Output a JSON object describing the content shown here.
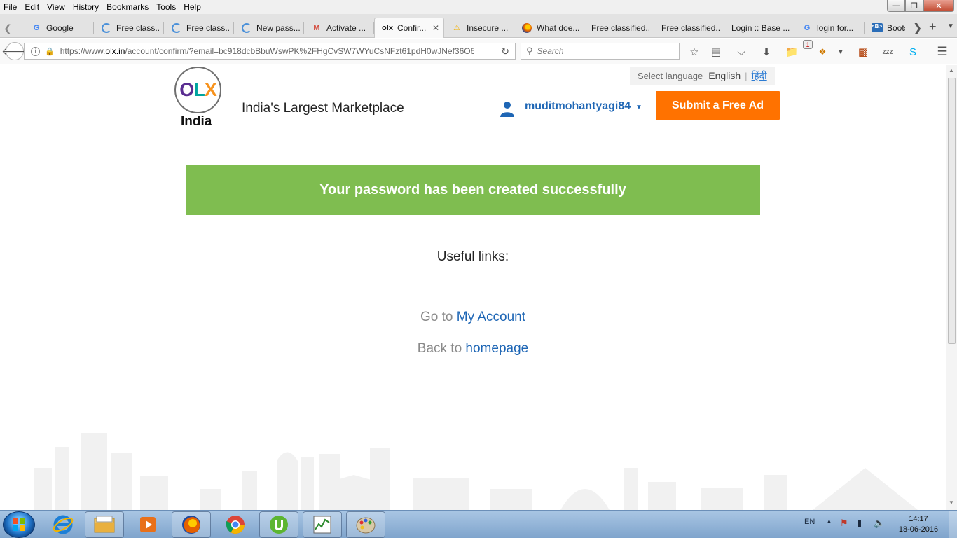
{
  "menubar": {
    "items": [
      "File",
      "Edit",
      "View",
      "History",
      "Bookmarks",
      "Tools",
      "Help"
    ]
  },
  "tabs": [
    {
      "title": "Google",
      "icon": "google-icon",
      "active": false
    },
    {
      "title": "Free class...",
      "icon": "loading-icon",
      "active": false
    },
    {
      "title": "Free class...",
      "icon": "loading-icon",
      "active": false
    },
    {
      "title": "New pass...",
      "icon": "loading-icon",
      "active": false
    },
    {
      "title": "Activate ...",
      "icon": "gmail-icon",
      "active": false
    },
    {
      "title": "Confir...",
      "icon": "olx-icon",
      "active": true
    },
    {
      "title": "Insecure ...",
      "icon": "warning-icon",
      "active": false
    },
    {
      "title": "What doe...",
      "icon": "firefox-icon",
      "active": false
    },
    {
      "title": "Free classified...",
      "icon": "none",
      "active": false
    },
    {
      "title": "Free classified...",
      "icon": "none",
      "active": false
    },
    {
      "title": "Login :: Base ...",
      "icon": "none",
      "active": false
    },
    {
      "title": "login for...",
      "icon": "google-icon",
      "active": false
    },
    {
      "title": "Bootst",
      "icon": "bootstrap-icon",
      "active": false
    }
  ],
  "navbar": {
    "url_prefix": "https://www.",
    "url_domain": "olx.in",
    "url_rest": "/account/confirm/?email=bc918dcbBbuWswPK%2FHgCvSW7WYuCsNFzt61pdH0wJNef36O6\\",
    "search_placeholder": "Search",
    "downloads_badge": "1"
  },
  "page": {
    "logo_letters": [
      "O",
      "L",
      "X"
    ],
    "country": "India",
    "tagline": "India's Largest Marketplace",
    "language": {
      "label": "Select language",
      "english": "English",
      "separator": "|",
      "hindi": "हिंदी"
    },
    "username": "muditmohantyagi84",
    "submit_ad": "Submit a Free Ad",
    "success_message": "Your password has been created successfully",
    "useful_links_heading": "Useful links:",
    "links": [
      {
        "prefix": "Go to",
        "link_text": "My Account"
      },
      {
        "prefix": "Back to",
        "link_text": "homepage"
      }
    ],
    "colors": {
      "brand_orange": "#ff7200",
      "success_green": "#7fbd50",
      "link_blue": "#1e66b5"
    }
  },
  "taskbar": {
    "apps": [
      "internet-explorer-icon",
      "file-explorer-icon",
      "media-player-icon",
      "firefox-icon",
      "chrome-icon",
      "utorrent-icon",
      "task-manager-icon",
      "paint-icon"
    ],
    "language": "EN",
    "time": "14:17",
    "date": "18-06-2016"
  }
}
